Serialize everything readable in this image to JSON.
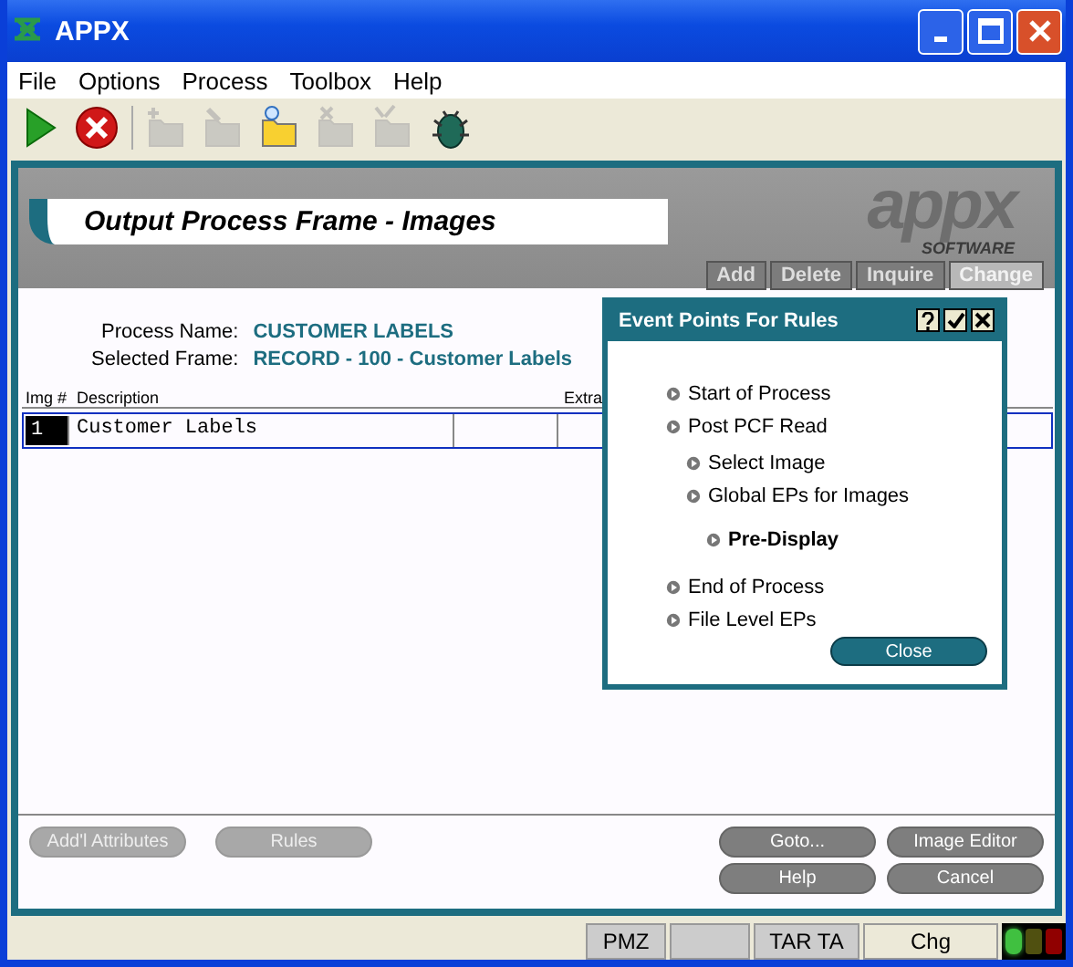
{
  "window": {
    "title": "APPX"
  },
  "menu": [
    "File",
    "Options",
    "Process",
    "Toolbox",
    "Help"
  ],
  "toolbar": [
    {
      "kind": "run",
      "disabled": false
    },
    {
      "kind": "stop",
      "disabled": false
    },
    {
      "kind": "new",
      "disabled": true
    },
    {
      "kind": "edit",
      "disabled": true
    },
    {
      "kind": "find",
      "disabled": false
    },
    {
      "kind": "delete",
      "disabled": true
    },
    {
      "kind": "approve",
      "disabled": true
    },
    {
      "kind": "bug",
      "disabled": false
    }
  ],
  "frame": {
    "title": "Output Process Frame - Images",
    "logo": "appx",
    "logo_sub": "SOFTWARE",
    "actions": [
      {
        "label": "Add",
        "selected": false
      },
      {
        "label": "Delete",
        "selected": false
      },
      {
        "label": "Inquire",
        "selected": false
      },
      {
        "label": "Change",
        "selected": true
      }
    ],
    "fields": [
      {
        "label": "Process Name:",
        "value": "CUSTOMER LABELS"
      },
      {
        "label": "Selected Frame:",
        "value": "RECORD - 100 - Customer Labels"
      }
    ],
    "table": {
      "columns": [
        "Img #",
        "Description",
        "Extra"
      ],
      "rows": [
        {
          "number": "1",
          "description": "Customer Labels"
        }
      ]
    },
    "buttons_left": [
      {
        "label": "Add'l Attributes",
        "disabled": true
      },
      {
        "label": "Rules",
        "disabled": true
      }
    ],
    "buttons_right": [
      {
        "label": "Goto...",
        "disabled": false
      },
      {
        "label": "Image Editor",
        "disabled": false
      },
      {
        "label": "Help",
        "disabled": false
      },
      {
        "label": "Cancel",
        "disabled": false
      }
    ]
  },
  "dialog": {
    "title": "Event Points For Rules",
    "items": [
      {
        "label": "Start of Process",
        "selected": false
      },
      {
        "label": "Post PCF Read",
        "selected": false,
        "children": [
          {
            "label": "Select Image",
            "selected": false
          },
          {
            "label": "Global EPs for Images",
            "selected": false,
            "children": [
              {
                "label": "Pre-Display",
                "selected": true
              }
            ]
          }
        ]
      },
      {
        "label": "End of Process",
        "selected": false
      },
      {
        "label": "File Level EPs",
        "selected": false
      }
    ],
    "button": "Close"
  },
  "status_bar": {
    "cells": [
      "PMZ",
      "TAR TA",
      "Chg"
    ],
    "lights": [
      {
        "color": "#40c040",
        "on": true
      },
      {
        "color": "#505010",
        "on": false
      },
      {
        "color": "#900000",
        "on": false
      }
    ]
  }
}
